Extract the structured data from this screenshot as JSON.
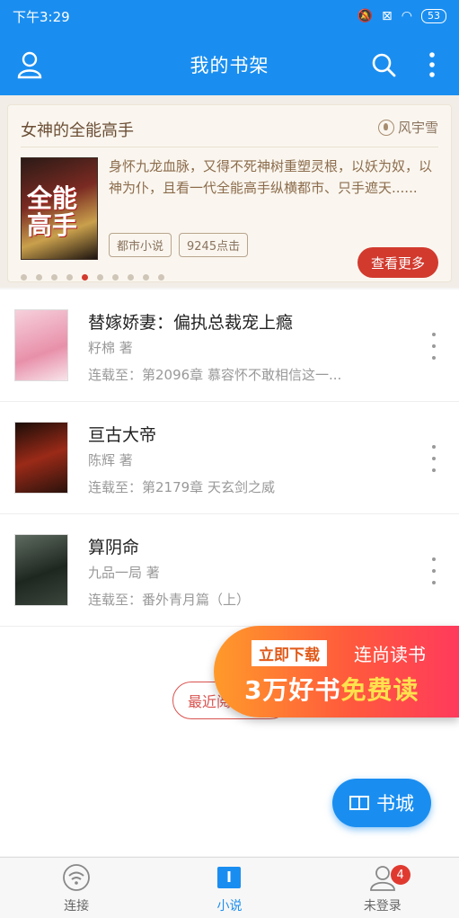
{
  "status_bar": {
    "time": "下午3:29",
    "battery": "53"
  },
  "header": {
    "title": "我的书架"
  },
  "banner": {
    "title": "女神的全能高手",
    "author": "风宇雪",
    "description": "身怀九龙血脉，又得不死神树重塑灵根，以妖为奴，以神为仆，且看一代全能高手纵横都市、只手遮天......",
    "tags": [
      "都市小说",
      "9245点击"
    ],
    "more_label": "查看更多",
    "cover_text": "全能高手",
    "page_index": 5,
    "page_count": 10
  },
  "books": [
    {
      "title": "替嫁娇妻：偏执总裁宠上瘾",
      "author": "籽棉 著",
      "latest": "连载至：第2096章 慕容怀不敢相信这一...",
      "cover_color": "#f0b8c8"
    },
    {
      "title": "亘古大帝",
      "author": "陈辉 著",
      "latest": "连载至：第2179章 天玄剑之威",
      "cover_color": "#5a1a12"
    },
    {
      "title": "算阴命",
      "author": "九品一局 著",
      "latest": "连载至：番外青月篇（上）",
      "cover_color": "#2e3a30"
    }
  ],
  "recent_label": "最近阅",
  "ad": {
    "download_label": "立即下载",
    "brand": "连尚读书",
    "slogan_a": "3万好书",
    "slogan_b": "免费读"
  },
  "store_label": "书城",
  "tabs": [
    {
      "label": "连接",
      "icon": "wifi-icon"
    },
    {
      "label": "小说",
      "icon": "book-icon"
    },
    {
      "label": "未登录",
      "icon": "user-icon",
      "badge": "4"
    }
  ],
  "colors": {
    "primary": "#1a8ef0",
    "accent": "#d23a2e"
  }
}
